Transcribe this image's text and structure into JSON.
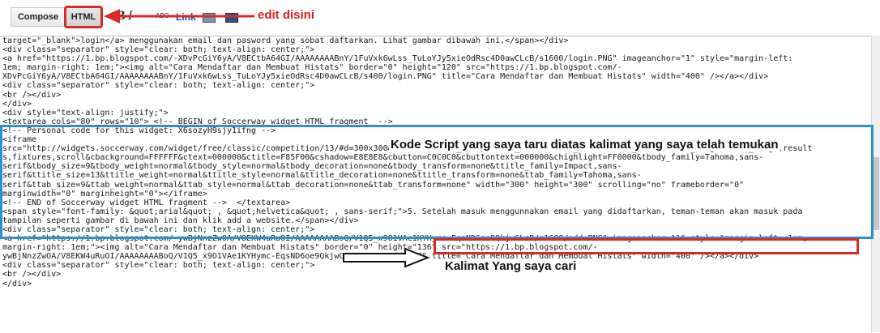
{
  "toolbar": {
    "compose_label": "Compose",
    "html_label": "HTML",
    "bold_label": "B",
    "italic_label": "I",
    "strike_label": "ABC",
    "link_label": "Link"
  },
  "annotations": {
    "edit_here": "edit disini",
    "script_note": "Kode Script yang saya taru diatas  kalimat yang saya telah temukan",
    "sentence_note": "Kalimat Yang saya cari"
  },
  "editor": {
    "lines": [
      "target=\"_blank\">login</a> menggunakan email dan pasword yang sobat daftarkan. Lihat gambar dibawah ini.</span></div>",
      "<div class=\"separator\" style=\"clear: both; text-align: center;\">",
      "<a href=\"https://1.bp.blogspot.com/-XDvPcGiY6yA/V8ECtbA64GI/AAAAAAAABnY/1FuVxk6wLss_TuLoYJy5xieOdRsc4D0awCLcB/s1600/login.PNG\" imageanchor=\"1\" style=\"margin-left:",
      "1em; margin-right: 1em;\"><img alt=\"Cara Mendaftar dan Membuat Histats\" border=\"0\" height=\"120\" src=\"https://1.bp.blogspot.com/-",
      "XDvPcGiY6yA/V8ECtbA64GI/AAAAAAAABnY/1FuVxk6wLss_TuLoYJy5xieOdRsc4D0awCLcB/s400/login.PNG\" title=\"Cara Mendaftar dan Membuat Histats\" width=\"400\" /></a></div>",
      "<div class=\"separator\" style=\"clear: both; text-align: center;\">",
      "<br /></div>",
      "</div>",
      "<div style=\"text-align: justify;\">",
      "<textarea cols=\"80\" rows=\"10\"> <!-- BEGIN of Soccerway widget HTML fragment  -->",
      "<!-- Personal code for this widget: X6sozyH9sjy1ifng -->",
      "<iframe",
      "src=\"http://widgets.soccerway.com/widget/free/classic/competition/13/#d=300x300&f=table,table_colmp,table_colmw,table_colmd,table_colml,table_colgf,table_colga,result",
      "s,fixtures,scroll&cbackground=FFFFFF&ctext=000000&ctitle=F85F00&cshadow=E8E8E8&cbutton=C0C0C0&cbuttontext=000000&chighlight=FF0000&tbody_family=Tahoma,sans-",
      "serif&tbody_size=9&tbody_weight=normal&tbody_style=normal&tbody_decoration=none&tbody_transform=none&ttitle_family=Impact,sans-",
      "serif&ttitle_size=13&ttitle_weight=normal&ttitle_style=normal&ttitle_decoration=none&ttitle_transform=none&ttab_family=Tahoma,sans-",
      "serif&ttab_size=9&ttab_weight=normal&ttab_style=normal&ttab_decoration=none&ttab_transform=none\" width=\"300\" height=\"300\" scrolling=\"no\" frameborder=\"0\"",
      "marginwidth=\"0\" marginheight=\"0\"></iframe>",
      "<!-- END of Soccerway widget HTML fragment -->  </textarea>",
      "<span style=\"font-family: &quot;arial&quot; , &quot;helvetica&quot; , sans-serif;\">5. Setelah masuk menggunnakan email yang didaftarkan, teman-teman akan masuk pada",
      "tampilan seperti gambar di bawah ini dan klik add a website.</span></div>",
      "<div class=\"separator\" style=\"clear: both; text-align: center;\">",
      "<a href=\"https://1.bp.blogspot.com/-ywBjNnzZwOA/V8EKW4uRuOI/AAAAAAAABoQ/V1Q5_x9O1VAe1KYHymc-EqsND6oe9QkjwCLcB/s1600/add.PNG\" imageanchor=\"1\" style=\"margin-left: 1em;",
      "margin-right: 1em;\"><img alt=\"Cara Mendaftar dan Membuat Histats\" border=\"0\" height=\"136\" src=\"https://1.bp.blogspot.com/-",
      "ywBjNnzZwOA/V8EKW4uRuOI/AAAAAAAABoQ/V1Q5_x9O1VAe1KYHymc-EqsND6oe9QkjwCLcB/s400/add.PNG\" title=\"Cara Mendaftar dan Membuat Histats\" width=\"400\" /></a></div>",
      "<div class=\"separator\" style=\"clear: both; text-align: center;\">",
      "<br /></div>",
      "</div>"
    ]
  },
  "colors": {
    "annotation_red": "#d62a2a",
    "highlight_blue": "#2d8fd6"
  }
}
